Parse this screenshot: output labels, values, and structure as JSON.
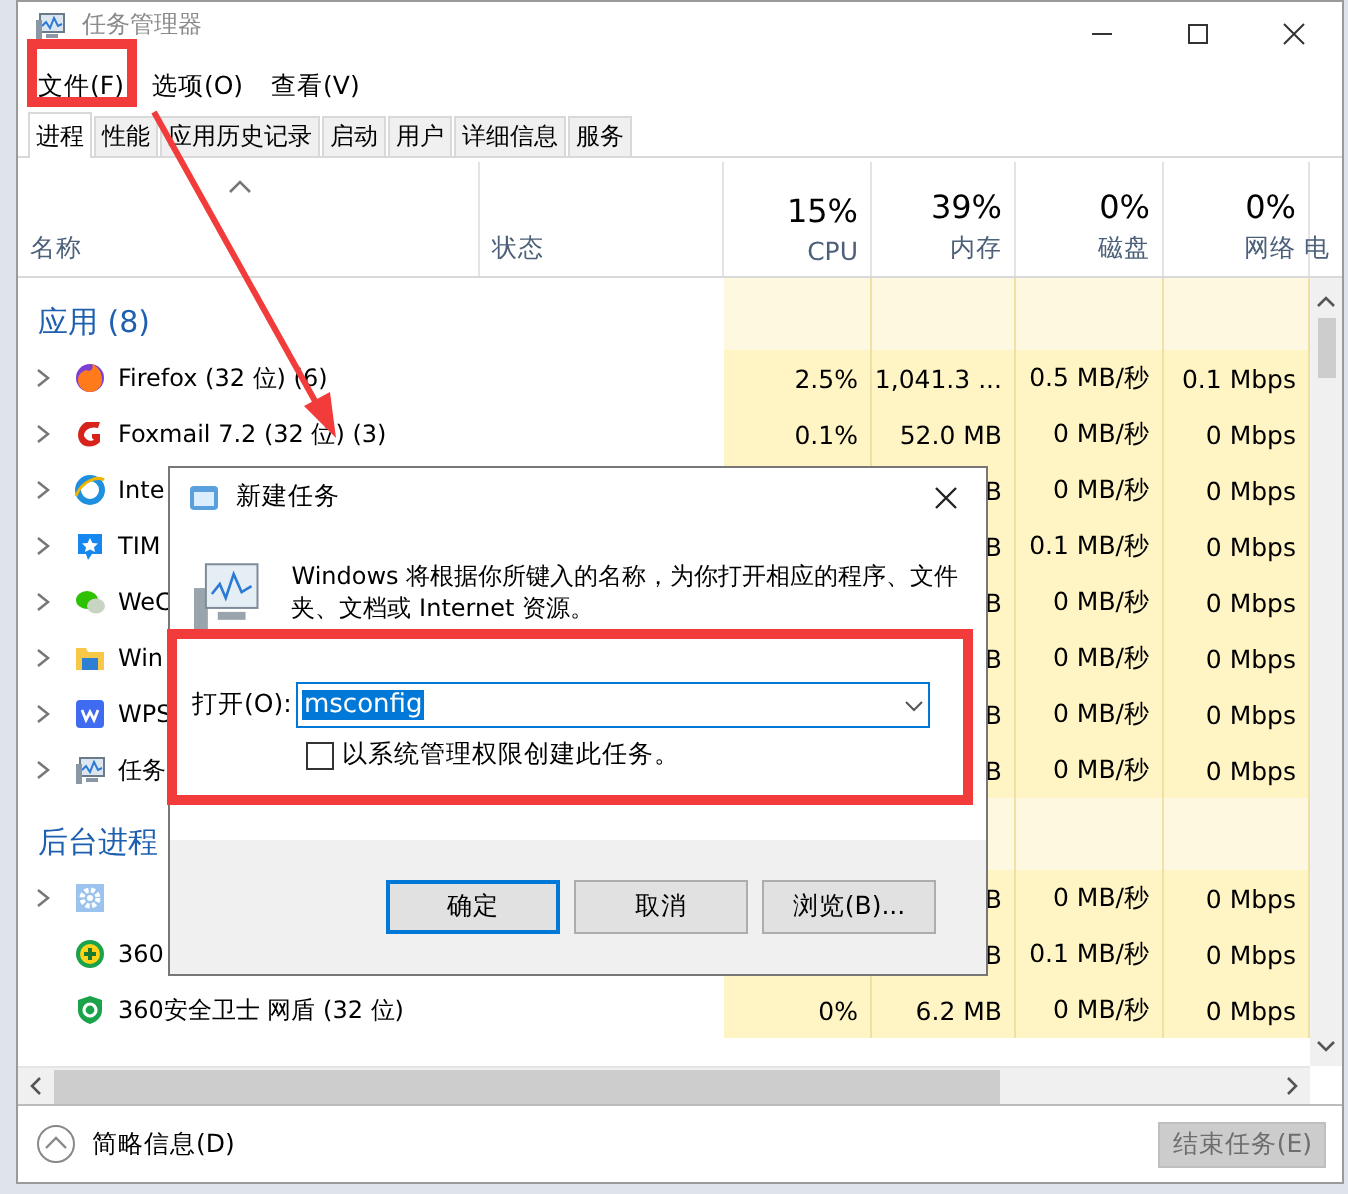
{
  "window": {
    "title": "任务管理器"
  },
  "menu": [
    "文件(F)",
    "选项(O)",
    "查看(V)"
  ],
  "tabs": [
    {
      "label": "进程",
      "selected": true
    },
    {
      "label": "性能",
      "selected": false
    },
    {
      "label": "应用历史记录",
      "selected": false
    },
    {
      "label": "启动",
      "selected": false
    },
    {
      "label": "用户",
      "selected": false
    },
    {
      "label": "详细信息",
      "selected": false
    },
    {
      "label": "服务",
      "selected": false
    }
  ],
  "columns": [
    {
      "label": "名称"
    },
    {
      "label": "状态"
    },
    {
      "usage": "15%",
      "label": "CPU"
    },
    {
      "usage": "39%",
      "label": "内存"
    },
    {
      "usage": "0%",
      "label": "磁盘"
    },
    {
      "usage": "0%",
      "label": "网络"
    },
    {
      "label": "电"
    }
  ],
  "rows": [
    {
      "kind": "group",
      "label": "应用 (8)"
    },
    {
      "kind": "process",
      "expandable": true,
      "name": "Firefox (32 位) (6)",
      "cpu": "2.5%",
      "memory": "1,041.3 ...",
      "disk": "0.5 MB/秒",
      "network": "0.1 Mbps"
    },
    {
      "kind": "process",
      "expandable": true,
      "name": "Foxmail 7.2 (32 位) (3)",
      "cpu": "0.1%",
      "memory": "52.0 MB",
      "disk": "0 MB/秒",
      "network": "0 Mbps"
    },
    {
      "kind": "process",
      "expandable": true,
      "name": "Inte",
      "memory": "B",
      "disk": "0 MB/秒",
      "network": "0 Mbps"
    },
    {
      "kind": "process",
      "expandable": true,
      "name": "TIM",
      "memory": "B",
      "disk": "0.1 MB/秒",
      "network": "0 Mbps"
    },
    {
      "kind": "process",
      "expandable": true,
      "name": "WeC",
      "memory": "B",
      "disk": "0 MB/秒",
      "network": "0 Mbps"
    },
    {
      "kind": "process",
      "expandable": true,
      "name": "Win",
      "memory": "B",
      "disk": "0 MB/秒",
      "network": "0 Mbps"
    },
    {
      "kind": "process",
      "expandable": true,
      "name": "WPS",
      "memory": "B",
      "disk": "0 MB/秒",
      "network": "0 Mbps"
    },
    {
      "kind": "process",
      "expandable": true,
      "name": "任务",
      "memory": "B",
      "disk": "0 MB/秒",
      "network": "0 Mbps"
    },
    {
      "kind": "group",
      "label": "后台进程"
    },
    {
      "kind": "process",
      "expandable": true,
      "memory": "B",
      "disk": "0 MB/秒",
      "network": "0 Mbps"
    },
    {
      "kind": "process",
      "expandable": false,
      "name": "360",
      "memory": "B",
      "disk": "0.1 MB/秒",
      "network": "0 Mbps"
    },
    {
      "kind": "process",
      "expandable": false,
      "name": "360安全卫士 网盾 (32 位)",
      "cpu": "0%",
      "memory": "6.2 MB",
      "disk": "0 MB/秒",
      "network": "0 Mbps"
    }
  ],
  "footer": {
    "details_toggle": "简略信息(D)",
    "end_task": {
      "label": "结束任务(E)",
      "disabled": true
    }
  },
  "dialog": {
    "title": "新建任务",
    "message": "Windows 将根据你所键入的名称，为你打开相应的程序、文件夹、文档或 Internet 资源。",
    "open_label": "打开(O):",
    "open_value": "msconfig",
    "checkbox": {
      "label": "以系统管理权限创建此任务。",
      "checked": false
    },
    "buttons": [
      {
        "label": "确定",
        "default": true
      },
      {
        "label": "取消",
        "default": false
      },
      {
        "label": "浏览(B)...",
        "default": false
      }
    ]
  },
  "annotations": [
    {
      "kind": "box"
    },
    {
      "kind": "box"
    },
    {
      "kind": "arrow"
    }
  ]
}
